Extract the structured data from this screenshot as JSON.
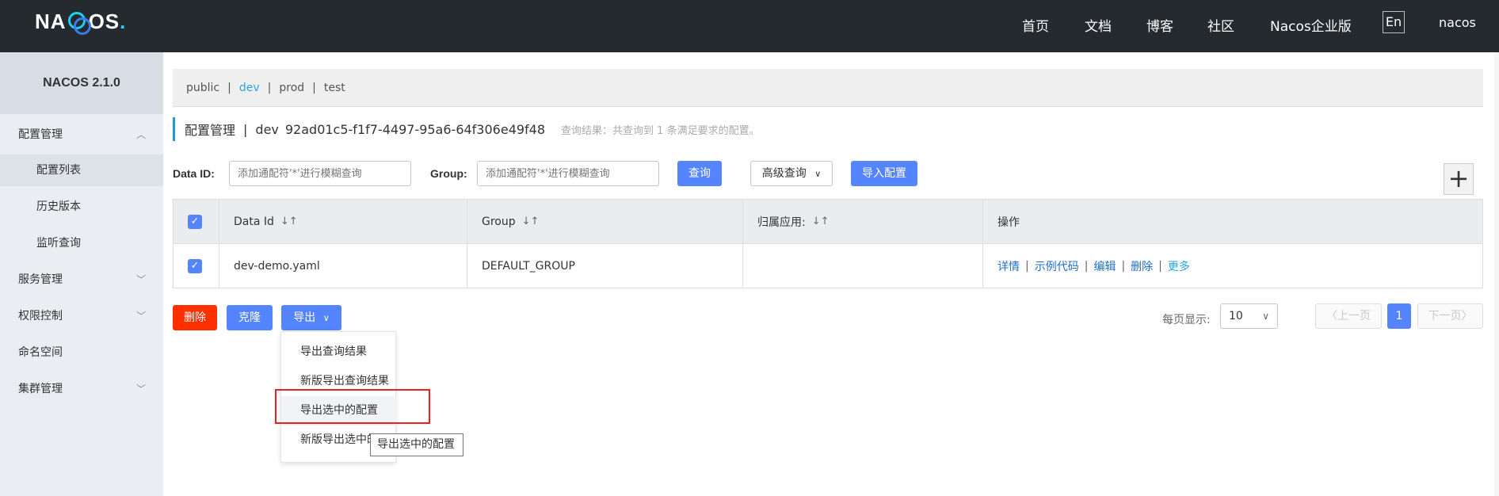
{
  "header": {
    "logo_text": "NACOS",
    "nav": [
      "首页",
      "文档",
      "博客",
      "社区",
      "Nacos企业版"
    ],
    "lang_button": "En",
    "user": "nacos"
  },
  "sidebar": {
    "version": "NACOS 2.1.0",
    "items": [
      {
        "label": "配置管理",
        "level": "top",
        "expanded": true
      },
      {
        "label": "配置列表",
        "level": "sub",
        "active": true
      },
      {
        "label": "历史版本",
        "level": "sub"
      },
      {
        "label": "监听查询",
        "level": "sub"
      },
      {
        "label": "服务管理",
        "level": "top"
      },
      {
        "label": "权限控制",
        "level": "top"
      },
      {
        "label": "命名空间",
        "level": "top"
      },
      {
        "label": "集群管理",
        "level": "top"
      }
    ]
  },
  "namespaces": [
    "public",
    "dev",
    "prod",
    "test"
  ],
  "active_namespace": "dev",
  "title": {
    "section": "配置管理",
    "separator": "|",
    "namespace": "dev",
    "namespace_id": "92ad01c5-f1f7-4497-95a6-64f306e49f48",
    "result_hint": "查询结果：共查询到 1 条满足要求的配置。"
  },
  "filters": {
    "dataid_label": "Data ID:",
    "dataid_placeholder": "添加通配符'*'进行模糊查询",
    "group_label": "Group:",
    "group_placeholder": "添加通配符'*'进行模糊查询",
    "search_button": "查询",
    "advanced_button": "高级查询",
    "import_button": "导入配置",
    "add_button": "+"
  },
  "table": {
    "headers": [
      "Data Id",
      "Group",
      "归属应用:",
      "操作"
    ],
    "sort_icon": "↓↑",
    "rows": [
      {
        "dataid": "dev-demo.yaml",
        "group": "DEFAULT_GROUP",
        "app": "",
        "checked": true
      }
    ],
    "actions": [
      "详情",
      "示例代码",
      "编辑",
      "删除",
      "更多"
    ]
  },
  "bulk": {
    "delete": "删除",
    "clone": "克隆",
    "export": "导出"
  },
  "pager": {
    "label": "每页显示:",
    "page_size": "10",
    "prev": "上一页",
    "current": "1",
    "next": "下一页"
  },
  "export_menu": [
    "导出查询结果",
    "新版导出查询结果",
    "导出选中的配置",
    "新版导出选中的配置"
  ],
  "tooltip": "导出选中的配置",
  "colors": {
    "topbar": "#252a2f",
    "primary": "#5584ff",
    "danger": "#ff3000",
    "highlight_box": "#e8231e",
    "link": "#1e6fc8"
  }
}
